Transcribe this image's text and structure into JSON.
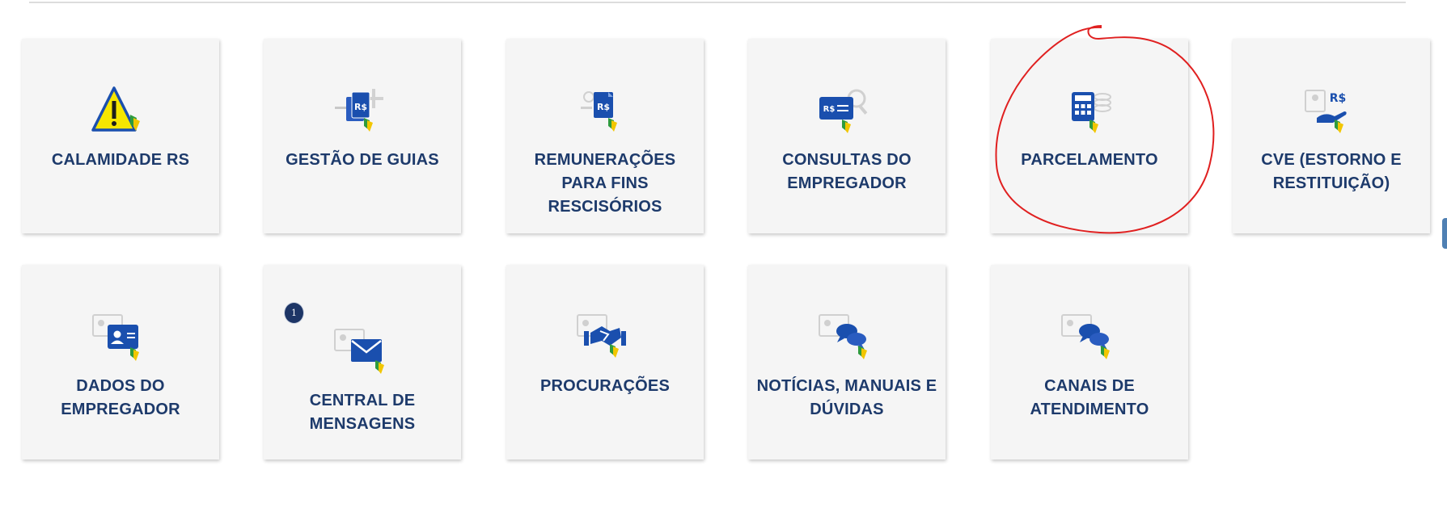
{
  "tiles": [
    {
      "label": "CALAMIDADE RS",
      "icon": "warning-icon"
    },
    {
      "label": "GESTÃO DE GUIAS",
      "icon": "guide-management-icon"
    },
    {
      "label": "REMUNERAÇÕES PARA FINS RESCISÓRIOS",
      "icon": "severance-pay-icon"
    },
    {
      "label": "CONSULTAS DO EMPREGADOR",
      "icon": "employer-search-icon"
    },
    {
      "label": "PARCELAMENTO",
      "icon": "calculator-icon"
    },
    {
      "label": "CVE (ESTORNO E RESTITUIÇÃO)",
      "icon": "refund-hand-icon"
    },
    {
      "label": "DADOS DO EMPREGADOR",
      "icon": "id-card-icon"
    },
    {
      "label": "CENTRAL DE MENSAGENS",
      "icon": "envelope-icon",
      "badge": "1"
    },
    {
      "label": "PROCURAÇÕES",
      "icon": "handshake-icon"
    },
    {
      "label": "NOTÍCIAS, MANUAIS E DÚVIDAS",
      "icon": "chat-bubbles-icon"
    },
    {
      "label": "CANAIS DE ATENDIMENTO",
      "icon": "support-chat-icon"
    }
  ],
  "colors": {
    "tile_bg": "#f5f5f5",
    "label": "#1d3a6b",
    "icon_blue": "#1a4fae",
    "annotation": "#e02020"
  }
}
